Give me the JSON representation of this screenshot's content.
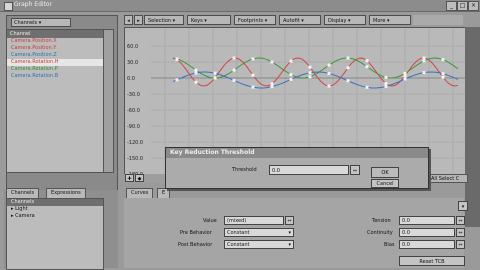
{
  "window": {
    "title": "Graph Editor"
  },
  "left_panel": {
    "dropdown": "Channels",
    "list_header": "Channel",
    "channels": [
      {
        "label": "Camera.Position.X",
        "color": "#c83a3a"
      },
      {
        "label": "Camera.Position.Y",
        "color": "#c83a3a"
      },
      {
        "label": "Camera.Position.Z",
        "color": "#2f6fb0"
      },
      {
        "label": "Camera.Rotation.H",
        "color": "#c83a3a",
        "selected": true
      },
      {
        "label": "Camera.Rotation.P",
        "color": "#2f8a2f"
      },
      {
        "label": "Camera.Rotation.B",
        "color": "#2f6fb0"
      }
    ]
  },
  "toolbar": {
    "selection": "Selection",
    "keys": "Keys",
    "footprints": "Footprints",
    "autofit": "Autofit",
    "display": "Display",
    "more": "More"
  },
  "graph": {
    "y_labels": [
      "60.0",
      "30.0",
      "0.0",
      "-30.0",
      "-60.0",
      "-90.0",
      "-120.0",
      "-150.0",
      "-180.0"
    ],
    "colors": {
      "red": "#d14545",
      "green": "#3a9a3a",
      "blue": "#3b6fc0",
      "white": "#f2f2f2"
    }
  },
  "lower_tabs": {
    "channels": "Channels",
    "expressions": "Expressions"
  },
  "tree": {
    "header": "Channels",
    "items": [
      "Light",
      "Camera"
    ]
  },
  "curves_tabs": {
    "curves": "Curves",
    "other": "E"
  },
  "curve_props": {
    "value_label": "Value",
    "value": "(mixed)",
    "pre_label": "Pre Behavior",
    "pre_value": "Constant",
    "post_label": "Post Behavior",
    "post_value": "Constant",
    "tension_label": "Tension",
    "tension_value": "0.0",
    "continuity_label": "Continuity",
    "continuity_value": "0.0",
    "bias_label": "Bias",
    "bias_value": "0.0",
    "reset_label": "Reset TCB"
  },
  "right_panel": {
    "label": "All Select C"
  },
  "dialog": {
    "title": "Key Reduction Threshold",
    "threshold_label": "Threshold",
    "threshold_value": "0.0",
    "ok": "OK",
    "cancel": "Cancel"
  }
}
